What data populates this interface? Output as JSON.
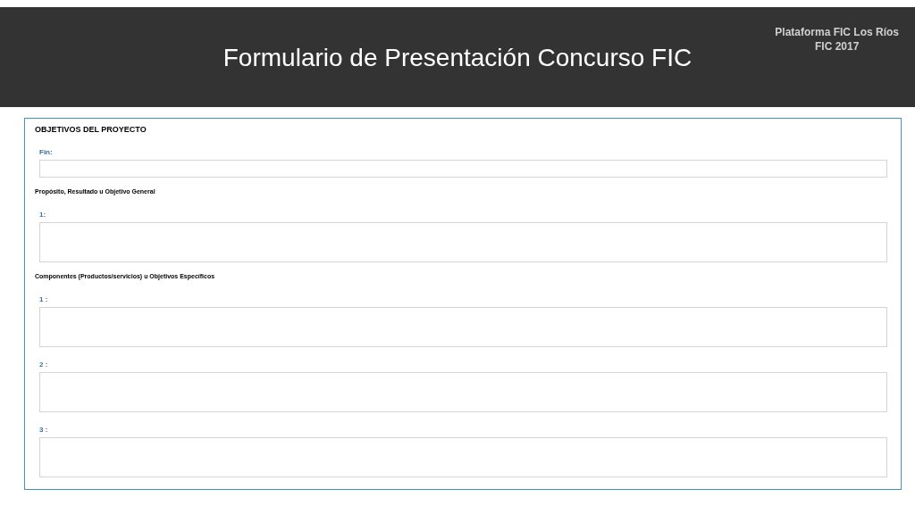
{
  "header": {
    "title": "Formulario de Presentación Concurso FIC",
    "platform": "Plataforma FIC Los Ríos",
    "edition": "FIC 2017"
  },
  "form": {
    "title": "OBJETIVOS DEL PROYECTO",
    "sections": [
      {
        "fields": [
          {
            "label": "Fin:",
            "kind": "line"
          }
        ]
      },
      {
        "heading": "Propósito, Resultado u Objetivo General",
        "fields": [
          {
            "label": "1:",
            "kind": "area"
          }
        ]
      },
      {
        "heading": "Componentes (Productos/servicios) u Objetivos Específicos",
        "fields": [
          {
            "label": "1 :",
            "kind": "area"
          },
          {
            "label": "2 :",
            "kind": "area"
          },
          {
            "label": "3 :",
            "kind": "area"
          }
        ]
      }
    ]
  }
}
